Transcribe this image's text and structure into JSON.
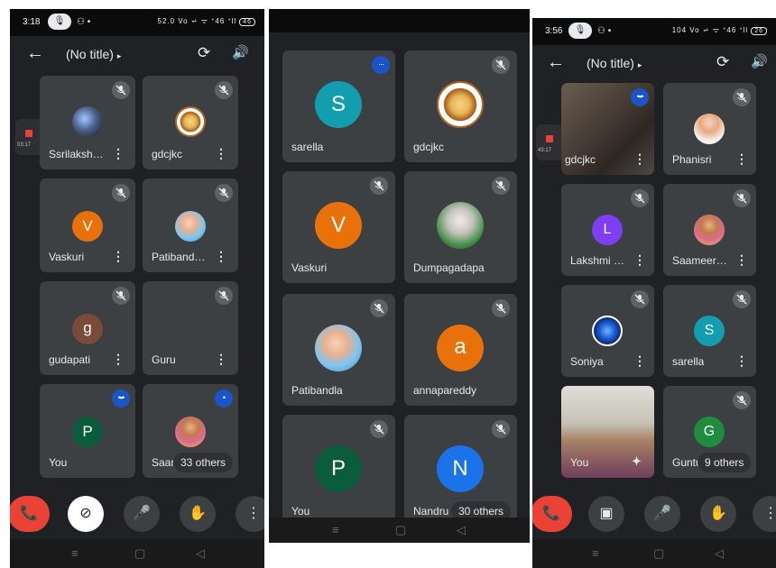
{
  "screens": [
    {
      "status": {
        "time": "3:18",
        "mic": "🎙",
        "misc": "⚇ •",
        "signal": "52.0 Vo ⩫ ᯤ ᐩ46 ᐩll",
        "battery": "46"
      },
      "title": "(No title)",
      "tiles": [
        {
          "name": "Ssrilaksh…",
          "avatar": "photo",
          "indicator": "muted"
        },
        {
          "name": "gdcjkc",
          "avatar": "emblem",
          "indicator": "muted"
        },
        {
          "name": "Vaskuri",
          "avatar": "V",
          "color": "#e8710a",
          "indicator": "muted"
        },
        {
          "name": "Patiband…",
          "avatar": "baby",
          "indicator": "muted"
        },
        {
          "name": "gudapati",
          "avatar": "g",
          "color": "#7b4b3a",
          "indicator": "muted"
        },
        {
          "name": "Guru",
          "avatar": "",
          "indicator": "muted"
        },
        {
          "name": "You",
          "avatar": "P",
          "color": "#0b5b3d",
          "indicator": "speaking"
        },
        {
          "name": "Saar",
          "avatar": "woman",
          "indicator": "speaking"
        }
      ],
      "others": "33 others",
      "rec_time": "03:17"
    },
    {
      "tiles": [
        {
          "name": "sarella",
          "avatar": "S",
          "color": "#129eaf",
          "indicator": "speaking"
        },
        {
          "name": "gdcjkc",
          "avatar": "emblem",
          "indicator": "muted"
        },
        {
          "name": "Vaskuri",
          "avatar": "V",
          "color": "#e8710a",
          "indicator": "muted"
        },
        {
          "name": "Dumpagadapa",
          "avatar": "old",
          "indicator": "muted"
        },
        {
          "name": "Patibandla",
          "avatar": "baby",
          "indicator": "muted"
        },
        {
          "name": "annapareddy",
          "avatar": "a",
          "color": "#e8710a",
          "indicator": "muted"
        },
        {
          "name": "You",
          "avatar": "P",
          "color": "#0b5b3d",
          "indicator": "muted"
        },
        {
          "name": "Nandru",
          "avatar": "N",
          "color": "#1a73e8",
          "indicator": "muted"
        }
      ],
      "others": "30 others"
    },
    {
      "status": {
        "time": "3:56",
        "mic": "🎙",
        "misc": "⚇ •",
        "signal": "104 Vo ⩫ ᯤ ᐩ46 ᐩll",
        "battery": "26"
      },
      "title": "(No title)",
      "tiles": [
        {
          "name": "gdcjkc",
          "avatar": "camera",
          "indicator": "speaking"
        },
        {
          "name": "Phanisri",
          "avatar": "flower",
          "indicator": "muted"
        },
        {
          "name": "Lakshmi …",
          "avatar": "L",
          "color": "#7e3ff2",
          "indicator": "muted"
        },
        {
          "name": "Saameer…",
          "avatar": "woman",
          "indicator": "muted"
        },
        {
          "name": "Soniya",
          "avatar": "blue",
          "indicator": "muted"
        },
        {
          "name": "sarella",
          "avatar": "S",
          "color": "#129eaf",
          "indicator": "muted"
        },
        {
          "name": "You",
          "avatar": "camera2",
          "indicator": "none"
        },
        {
          "name": "Guntu",
          "avatar": "G",
          "color": "#1e8e3e",
          "indicator": "muted"
        }
      ],
      "others": "9 others",
      "rec_time": "43:17"
    }
  ],
  "controls": {
    "end": "📞",
    "camera_off": "⊘",
    "camera_on": "▣",
    "mic": "🎤",
    "hand": "✋",
    "more": "⋮"
  },
  "nav": {
    "menu": "≡",
    "home": "▢",
    "back": "◁"
  },
  "icons": {
    "back": "←",
    "flip_camera": "⟳",
    "speaker": "🔊",
    "kebab": "⋮",
    "sparkle": "✦",
    "title_arrow": "▸"
  },
  "colors": {
    "background": "#202124",
    "tile": "#3c4043",
    "end_call": "#ea4335",
    "speaking": "#1a55c7"
  }
}
